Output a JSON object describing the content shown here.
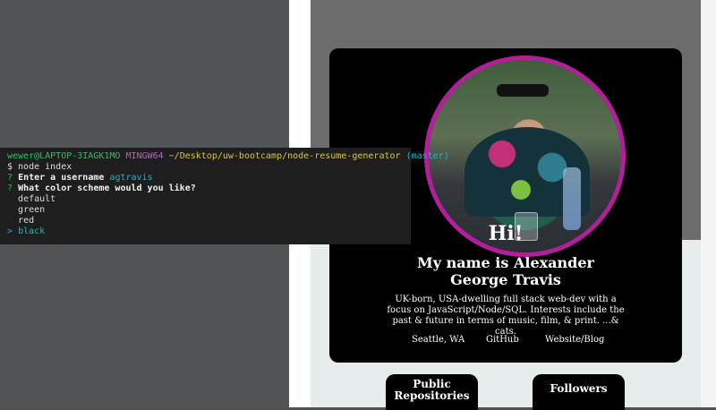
{
  "terminal": {
    "prompt_user": "wewer@LAPTOP-3IAGK1MO",
    "prompt_shell": "MINGW64",
    "prompt_path": "~/Desktop/uw-bootcamp/node-resume-generator",
    "prompt_branch": "(master)",
    "command": "$ node index",
    "q1_mark": "?",
    "q1_text": "Enter a username",
    "q1_answer": "agtravis",
    "q2_mark": "?",
    "q2_text": "What color scheme would you like?",
    "options": [
      "default",
      "green",
      "red"
    ],
    "selected_marker": ">",
    "selected_option": "black"
  },
  "profile": {
    "greeting": "Hi!",
    "name": "My name is Alexander George Travis",
    "bio": "UK-born, USA-dwelling full stack web-dev with a focus on JavaScript/Node/SQL. Interests include the past & future in terms of music, film, & print. ...& cats.",
    "location": "Seattle, WA",
    "github": "GitHub",
    "website": "Website/Blog"
  },
  "stats": {
    "repos_label": "Public Repositories",
    "followers_label": "Followers"
  },
  "colors": {
    "avatar_border": "#b31e9b",
    "prompt_user": "#22c55e",
    "prompt_shell": "#c15bd6",
    "prompt_path": "#d9c34a",
    "accent": "#2dafc7"
  }
}
